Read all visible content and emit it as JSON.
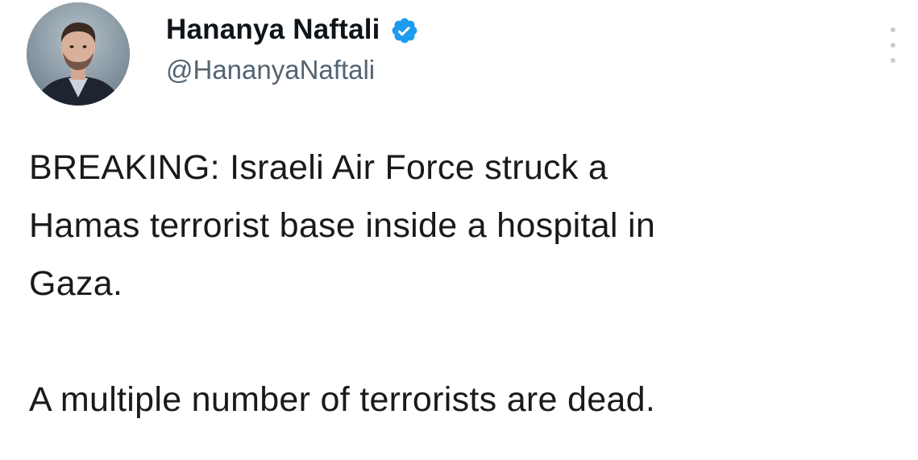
{
  "author": {
    "display_name": "Hananya Naftali",
    "handle": "@HananyaNaftali",
    "verified": true,
    "verified_icon": "verified-badge-icon",
    "verified_color": "#1d9bf0"
  },
  "tweet": {
    "lines": [
      "BREAKING: Israeli Air Force struck a",
      "Hamas terrorist base inside a hospital in",
      "Gaza."
    ],
    "second_paragraph": "A multiple number of terrorists are dead."
  },
  "actions": {
    "more_icon": "more-vertical-icon"
  },
  "colors": {
    "text": "#0f1419",
    "handle": "#536471",
    "background": "#ffffff"
  }
}
